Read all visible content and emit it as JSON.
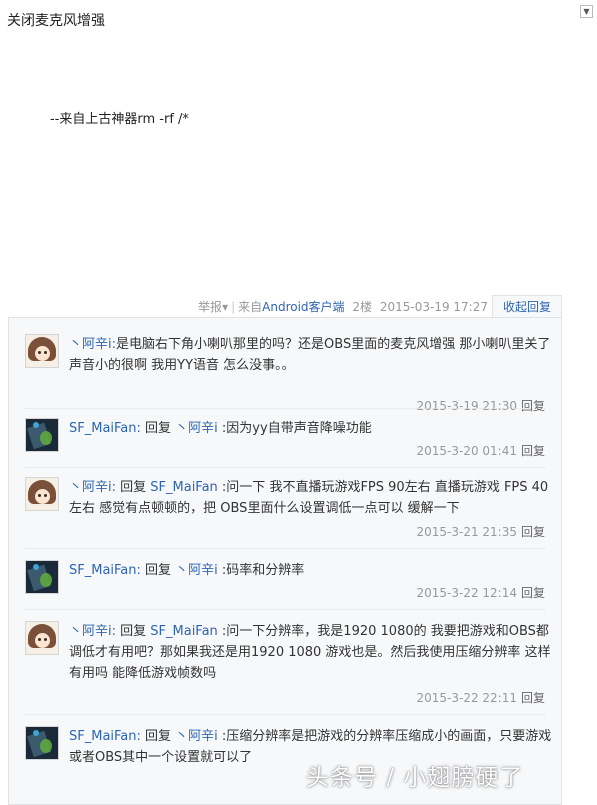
{
  "post": {
    "text": "关闭麦克风增强",
    "signature": "--来自上古神器rm -rf /*"
  },
  "meta": {
    "report": "举报",
    "report_arrow": "▾",
    "source_prefix": "来自",
    "source_link": "Android客户端",
    "floor": "2楼",
    "datetime": "2015-03-19 17:27",
    "collapse": "收起回复"
  },
  "replies": [
    {
      "avatar": "anime-girl-avatar",
      "author": "丶阿辛i",
      "colon": ":",
      "prefix": "",
      "target": "",
      "text": "是电脑右下角小喇叭那里的吗？还是OBS里面的麦克风增强 那小喇叭里关了声音小的很啊 我用YY语音 怎么没事。。",
      "time": "2015-3-19 21:30",
      "reply": "回复"
    },
    {
      "avatar": "game-avatar",
      "author": "SF_MaiFan",
      "colon": ":",
      "prefix": " 回复 ",
      "target": "丶阿辛i",
      "text": " :因为yy自带声音降噪功能",
      "time": "2015-3-20 01:41",
      "reply": "回复"
    },
    {
      "avatar": "anime-girl-avatar",
      "author": "丶阿辛i",
      "colon": ":",
      "prefix": " 回复 ",
      "target": "SF_MaiFan",
      "text": " :问一下 我不直播玩游戏FPS 90左右 直播玩游戏 FPS 40左右 感觉有点顿顿的，把 OBS里面什么设置调低一点可以 缓解一下",
      "time": "2015-3-21 21:35",
      "reply": "回复"
    },
    {
      "avatar": "game-avatar",
      "author": "SF_MaiFan",
      "colon": ":",
      "prefix": " 回复 ",
      "target": "丶阿辛i",
      "text": " :码率和分辨率",
      "time": "2015-3-22 12:14",
      "reply": "回复"
    },
    {
      "avatar": "anime-girl-avatar",
      "author": "丶阿辛i",
      "colon": ":",
      "prefix": " 回复 ",
      "target": "SF_MaiFan",
      "text": " :问一下分辨率，我是1920 1080的 我要把游戏和OBS都调低才有用吧？那如果我还是用1920 1080 游戏也是。然后我使用压缩分辨率 这样有用吗 能降低游戏帧数吗",
      "time": "2015-3-22 22:11",
      "reply": "回复"
    },
    {
      "avatar": "game-avatar",
      "author": "SF_MaiFan",
      "colon": ":",
      "prefix": " 回复 ",
      "target": "丶阿辛i",
      "text": " :压缩分辨率是把游戏的分辨率压缩成小的画面，只要游戏或者OBS其中一个设置就可以了",
      "time": "",
      "reply": ""
    }
  ],
  "watermark": "头条号 / 小翅膀硬了",
  "colors": {
    "link": "#2d64b3",
    "muted": "#999999",
    "panel_bg": "#f7f8fa",
    "panel_border": "#e1e2e3"
  }
}
